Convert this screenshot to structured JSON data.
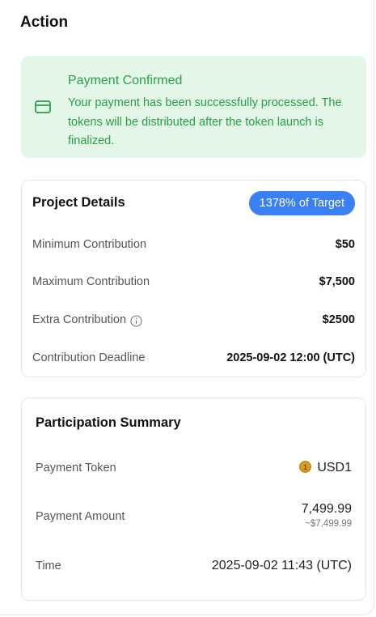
{
  "page": {
    "title": "Action"
  },
  "alert": {
    "icon": "card-icon",
    "title": "Payment Confirmed",
    "message": "Your payment has been successfully processed. The tokens will be distributed after the token launch is finalized.",
    "color": "#27a047",
    "background": "#e3f6e7"
  },
  "project_details": {
    "title": "Project Details",
    "badge": "1378% of Target",
    "badge_color": "#3b7ff5",
    "rows": [
      {
        "label": "Minimum Contribution",
        "value": "$50"
      },
      {
        "label": "Maximum Contribution",
        "value": "$7,500"
      },
      {
        "label": "Extra Contribution",
        "value": "$2500",
        "icon": "info-icon"
      },
      {
        "label": "Contribution Deadline",
        "value": "2025-09-02 12:00 (UTC)"
      }
    ]
  },
  "participation_summary": {
    "title": "Participation Summary",
    "payment_token": {
      "label": "Payment Token",
      "value": "USD1",
      "icon": "usd1-token-icon",
      "icon_color": "#c88a0f"
    },
    "payment_amount": {
      "label": "Payment Amount",
      "value": "7,499.99",
      "usd_value": "~$7,499.99"
    },
    "time": {
      "label": "Time",
      "value": "2025-09-02 11:43 (UTC)"
    }
  }
}
